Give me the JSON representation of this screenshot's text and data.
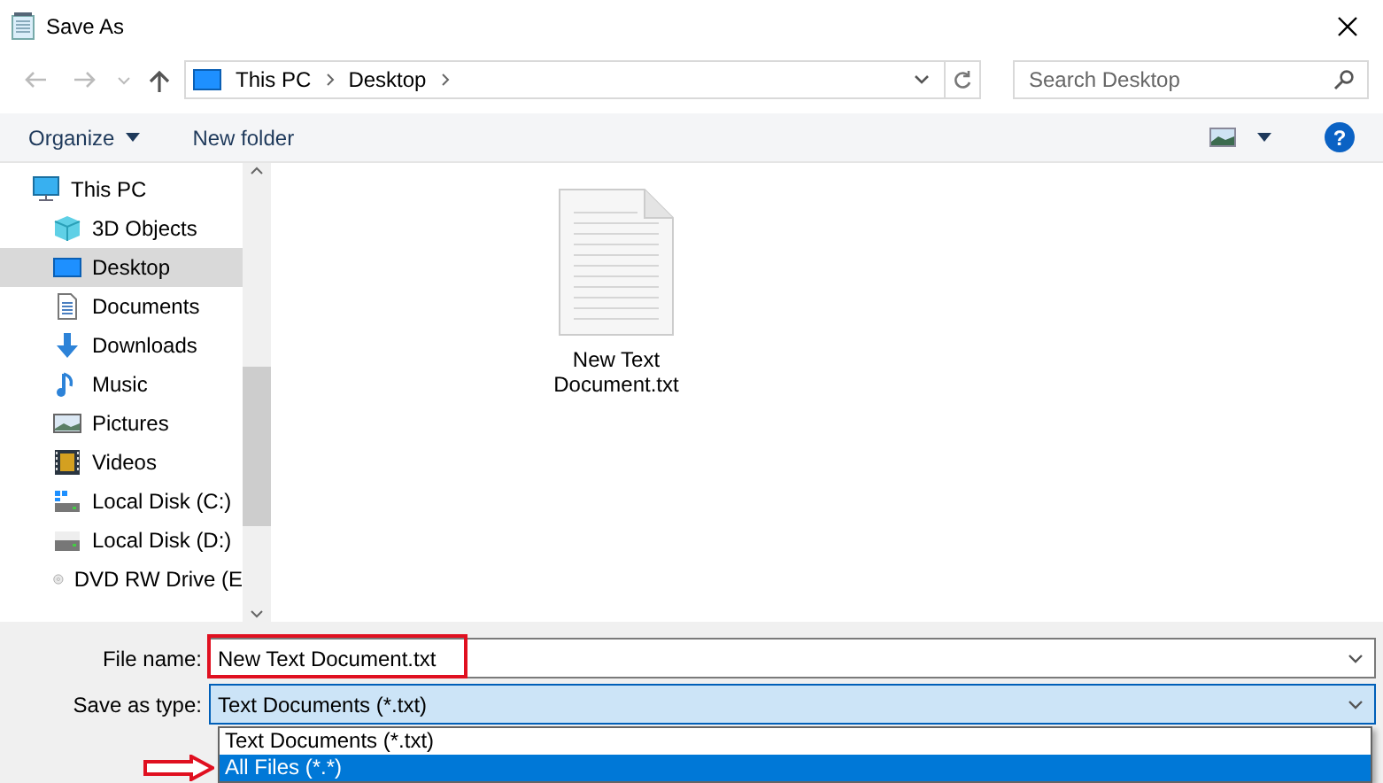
{
  "window": {
    "title": "Save As"
  },
  "address_bar": {
    "crumbs": [
      "This PC",
      "Desktop"
    ]
  },
  "search": {
    "placeholder": "Search Desktop"
  },
  "toolbar": {
    "organize": "Organize",
    "new_folder": "New folder",
    "help": "?"
  },
  "sidebar": {
    "items": [
      {
        "label": "This PC",
        "kind": "pc",
        "selected": false,
        "children": [
          {
            "label": "3D Objects",
            "kind": "objects",
            "selected": false
          },
          {
            "label": "Desktop",
            "kind": "desktop",
            "selected": true
          },
          {
            "label": "Documents",
            "kind": "documents",
            "selected": false
          },
          {
            "label": "Downloads",
            "kind": "downloads",
            "selected": false
          },
          {
            "label": "Music",
            "kind": "music",
            "selected": false
          },
          {
            "label": "Pictures",
            "kind": "pictures",
            "selected": false
          },
          {
            "label": "Videos",
            "kind": "videos",
            "selected": false
          },
          {
            "label": "Local Disk (C:)",
            "kind": "system-disk",
            "selected": false
          },
          {
            "label": "Local Disk (D:)",
            "kind": "disk",
            "selected": false
          },
          {
            "label": "DVD RW Drive (E",
            "kind": "dvd",
            "selected": false
          }
        ]
      }
    ]
  },
  "files": [
    {
      "name": "New Text Document.txt"
    }
  ],
  "file_name": {
    "label": "File name:",
    "value": "New Text Document.txt",
    "highlighted": true
  },
  "save_as_type": {
    "label": "Save as type:",
    "value": "Text Documents (*.txt)",
    "expanded": true,
    "options": [
      {
        "label": "Text Documents (*.txt)",
        "highlighted": false
      },
      {
        "label": "All Files  (*.*)",
        "highlighted": true,
        "pointed": true
      }
    ]
  }
}
